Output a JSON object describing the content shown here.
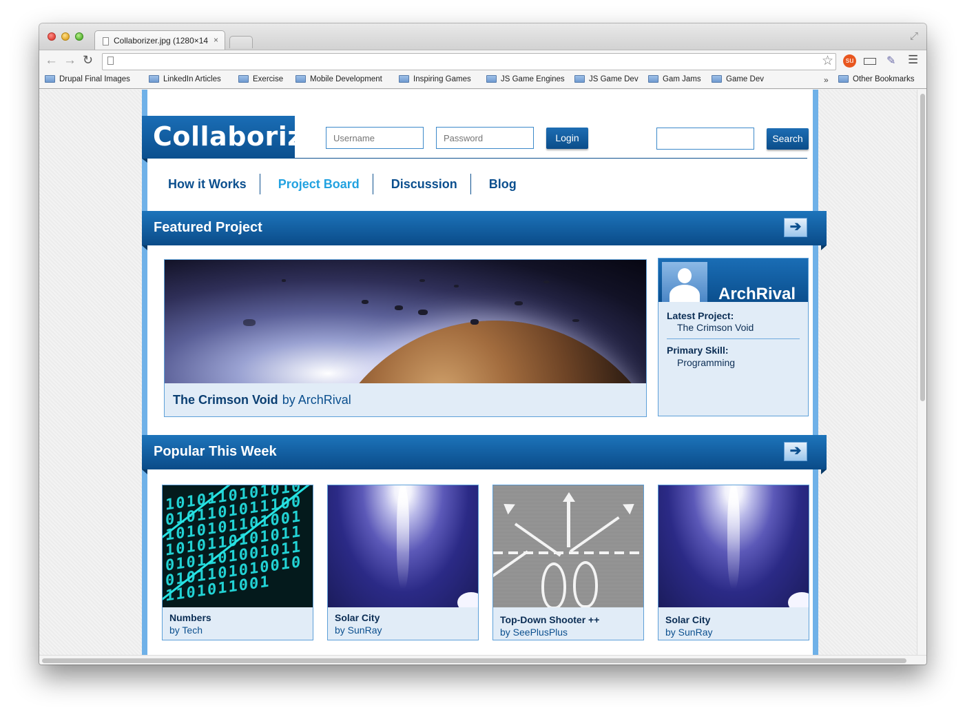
{
  "browser": {
    "tab_title": "Collaborizer.jpg (1280×14",
    "tab_close": "×",
    "url": "",
    "bookmarks": [
      "Drupal Final Images",
      "LinkedIn Articles",
      "Exercise",
      "Mobile Development",
      "Inspiring Games",
      "JS Game Engines",
      "JS Game Dev",
      "Gam Jams",
      "Game Dev"
    ],
    "bookmarks_overflow": "»",
    "other_bookmarks": "Other Bookmarks",
    "icons": [
      "back-arrow-icon",
      "forward-arrow-icon",
      "reload-icon",
      "star-icon",
      "stumbleupon-icon",
      "ruler-icon",
      "eyedropper-icon",
      "menu-icon",
      "folder-icon"
    ]
  },
  "site": {
    "logo": "Collaborizer",
    "username_placeholder": "Username",
    "password_placeholder": "Password",
    "login_label": "Login",
    "search_placeholder": "",
    "search_label": "Search",
    "nav": [
      {
        "label": "How it Works",
        "active": false
      },
      {
        "label": "Project Board",
        "active": true
      },
      {
        "label": "Discussion",
        "active": false
      },
      {
        "label": "Blog",
        "active": false
      }
    ],
    "accent_color": "#0b4f8e",
    "active_nav_color": "#22a2e0"
  },
  "featured": {
    "heading": "Featured Project",
    "arrow": "➔",
    "project_title": "The Crimson Void",
    "project_author": "by ArchRival"
  },
  "profile": {
    "name": "ArchRival",
    "latest_label": "Latest Project:",
    "latest_value": "The Crimson Void",
    "skill_label": "Primary Skill:",
    "skill_value": "Programming"
  },
  "popular": {
    "heading": "Popular This Week",
    "arrow": "➔",
    "items": [
      {
        "title": "Numbers",
        "author": "by Tech"
      },
      {
        "title": "Solar City",
        "author": "by SunRay"
      },
      {
        "title": "Top-Down Shooter ++",
        "author": "by SeePlusPlus"
      },
      {
        "title": "Solar City",
        "author": "by SunRay"
      }
    ]
  }
}
